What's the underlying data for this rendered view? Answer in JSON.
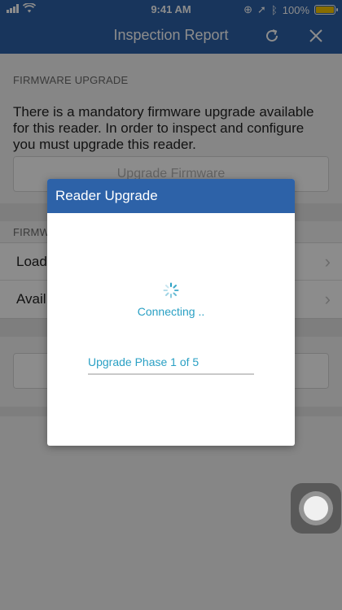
{
  "status_bar": {
    "time": "9:41 AM",
    "battery_percent": "100%",
    "battery_level": 1.0,
    "battery_color": "#f7c600"
  },
  "nav": {
    "title": "Inspection Report",
    "refresh_icon": "refresh-icon",
    "close_icon": "close-icon"
  },
  "firmware_section": {
    "header": "FIRMWARE UPGRADE",
    "message": "There is a mandatory firmware upgrade available for this reader. In order to inspect and configure you must upgrade this reader.",
    "button_label": "Upgrade Firmware"
  },
  "release_section": {
    "header_visible": "FIRMW",
    "rows": [
      {
        "label": "Load",
        "chevron": "›"
      },
      {
        "label": "Avail",
        "chevron": "›"
      }
    ]
  },
  "dialog": {
    "title": "Reader Upgrade",
    "status_text": "Connecting ..",
    "phase_label": "Upgrade Phase 1 of 5",
    "phase_progress": 0.0
  },
  "colors": {
    "brand_blue": "#2d62a8",
    "accent_teal": "#2aa0c4"
  }
}
